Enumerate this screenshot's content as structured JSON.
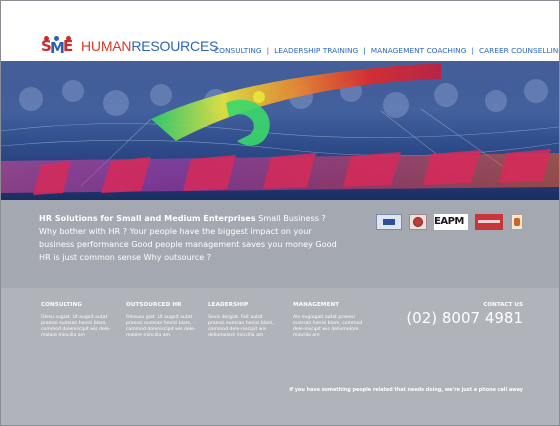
{
  "brand": {
    "mark": {
      "s": "S",
      "m": "M",
      "e": "E"
    },
    "name_part1": "HUMAN",
    "name_part2": "RESOURCES"
  },
  "nav": {
    "items": [
      "CONSULTING",
      "LEADERSHIP TRAINING",
      "MANAGEMENT COACHING",
      "CAREER COUNSELLING"
    ],
    "separator": "|"
  },
  "intro": {
    "heading": "HR Solutions for Small and Medium Enterprises",
    "body": " Small Business ? Why bother with HR ? Your people have the biggest impact on your business performance Good people management saves you money Good HR is just common sense Why outsource ?"
  },
  "partners": {
    "items": [
      "logo-1",
      "logo-2",
      "EAPM",
      "logo-4",
      "logo-5"
    ],
    "eapm_text": "EAPM"
  },
  "services": [
    {
      "title": "CONSULTING",
      "text": "Olesu sugiat. Ut augait autat praessi eumsan henisi blam, commod doleniscipit wis dele-molore mincilla am"
    },
    {
      "title": "OUTSOURCED HR",
      "text": "Olesusu giat. Ut augait autat praessi eumsan henisi blam, commod doleniscipit wis dele-molore mincilla am"
    },
    {
      "title": "LEADERSHIP",
      "text": "Sevis dergiat. Fait autat praessi eumsan henisi blam, commod dele-niscipit wis deliumolore mincilla am"
    },
    {
      "title": "MANAGEMENT",
      "text": "Ale eugiugait autat praessi eumsan henisi blam, commod dele-niscipit wis deliumolore mincilla am"
    }
  ],
  "contact": {
    "label": "CONTACT US",
    "phone": "(02) 8007 4981"
  },
  "footer": {
    "note": "If you have something people related that needs doing, we're just a phone call away"
  }
}
